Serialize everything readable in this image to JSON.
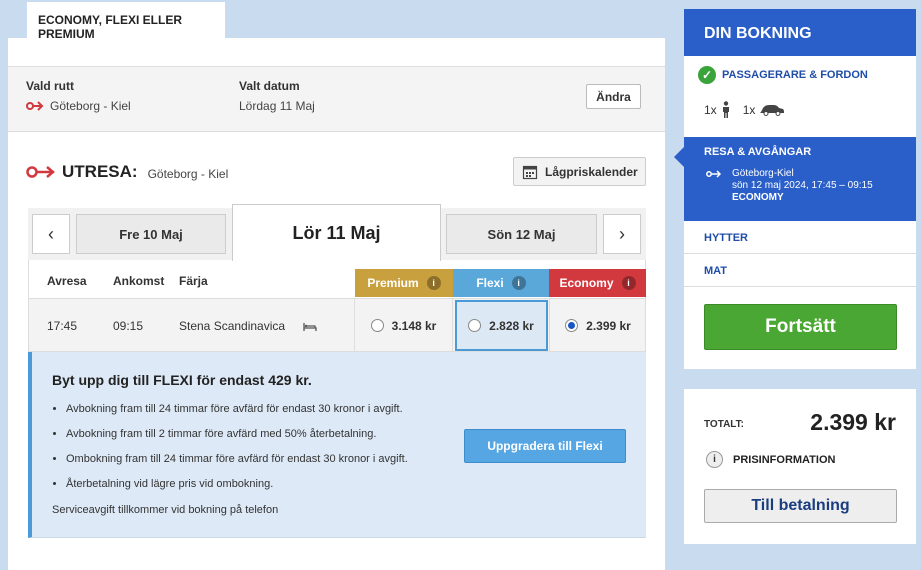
{
  "top_tab": "ECONOMY, FLEXI ELLER PREMIUM",
  "route": {
    "label": "Vald rutt",
    "value": "Göteborg - Kiel",
    "date_label": "Valt datum",
    "date_value": "Lördag 11 Maj",
    "change_button": "Ändra"
  },
  "utresa": {
    "title": "UTRESA:",
    "route": "Göteborg - Kiel",
    "calendar_button": "Lågpriskalender"
  },
  "dates": {
    "prev": "Fre 10 Maj",
    "active": "Lör 11 Maj",
    "next": "Sön 12 Maj"
  },
  "table": {
    "headers": {
      "depart": "Avresa",
      "arrive": "Ankomst",
      "ferry": "Färja"
    },
    "fares": [
      {
        "name": "Premium",
        "color": "#c9a03e"
      },
      {
        "name": "Flexi",
        "color": "#5aa7da"
      },
      {
        "name": "Economy",
        "color": "#d2393f"
      }
    ],
    "row": {
      "depart": "17:45",
      "arrive": "09:15",
      "ferry": "Stena Scandinavica",
      "premium": "3.148 kr",
      "flexi": "2.828 kr",
      "economy": "2.399 kr",
      "selected": "economy"
    }
  },
  "upgrade": {
    "title": "Byt upp dig till FLEXI för endast 429 kr.",
    "bullets": [
      "Avbokning fram till 24 timmar före avfärd för endast 30 kronor i avgift.",
      "Avbokning fram till 2 timmar före avfärd med 50% återbetalning.",
      "Ombokning fram till 24 timmar före avfärd för endast 30 kronor i avgift.",
      "Återbetalning vid lägre pris vid ombokning."
    ],
    "note": "Serviceavgift tillkommer vid bokning på telefon",
    "button": "Uppgradera till Flexi"
  },
  "booking": {
    "title": "DIN BOKNING",
    "step1": "PASSAGERARE & FORDON",
    "pax_count": "1x",
    "vehicle_count": "1x",
    "step2": "RESA & AVGÅNGAR",
    "trip_route": "Göteborg-Kiel",
    "trip_time": "sön 12 maj 2024, 17:45 – 09:15",
    "trip_class": "ECONOMY",
    "hytter": "HYTTER",
    "mat": "MAT",
    "continue": "Fortsätt"
  },
  "total": {
    "label": "TOTALT:",
    "amount": "2.399 kr",
    "price_info": "PRISINFORMATION",
    "pay_button": "Till betalning"
  }
}
